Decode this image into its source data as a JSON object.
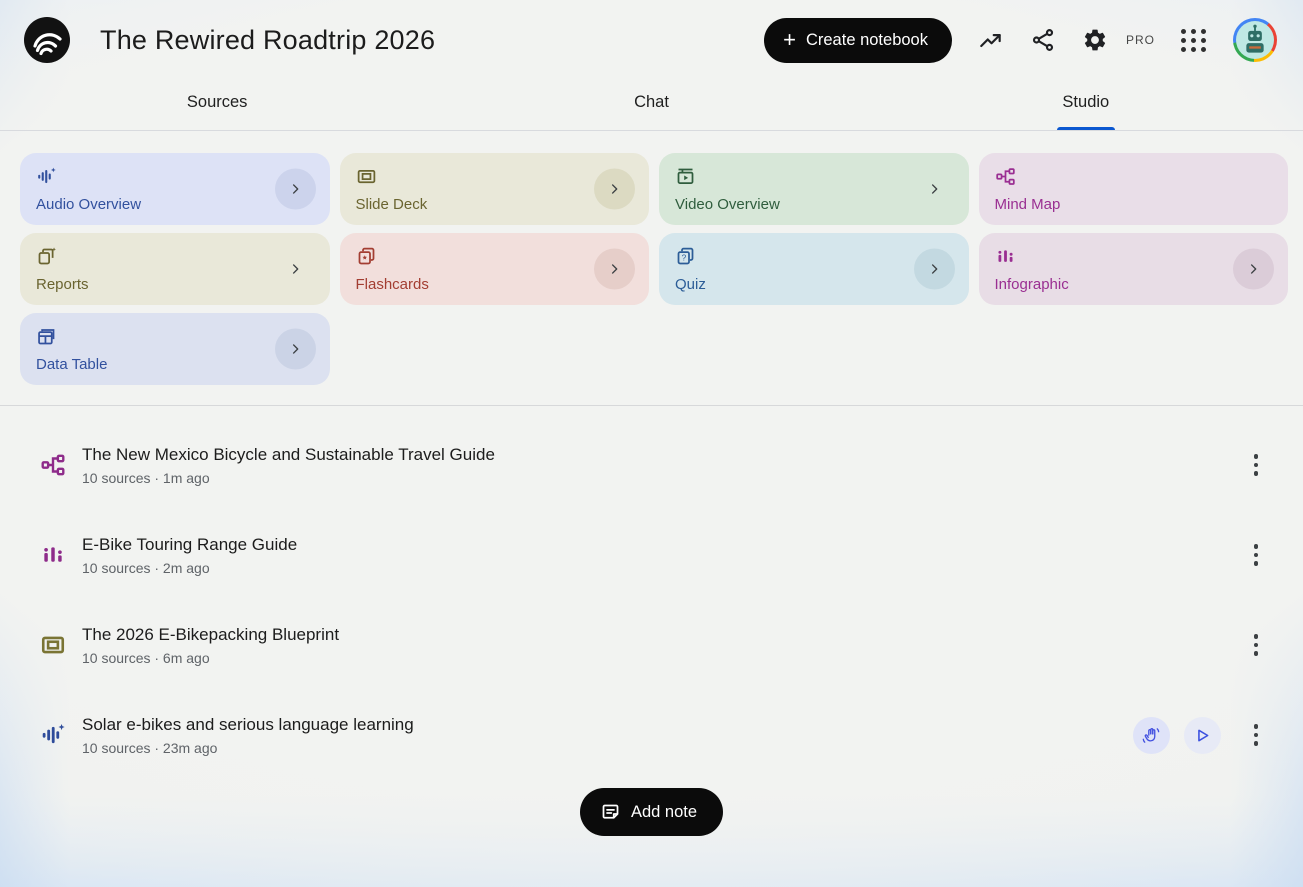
{
  "header": {
    "title": "The Rewired Roadtrip 2026",
    "create_button_label": "Create notebook",
    "plus_glyph": "+",
    "pro_label": "PRO",
    "icons": [
      "notebooklm-logo",
      "trending-up-icon",
      "share-icon",
      "settings-icon",
      "apps-grid-icon",
      "avatar"
    ]
  },
  "tabs": [
    {
      "label": "Sources",
      "active": false
    },
    {
      "label": "Chat",
      "active": false
    },
    {
      "label": "Studio",
      "active": true
    }
  ],
  "studio_cards": [
    {
      "label": "Audio Overview",
      "icon": "audio-waveform-icon",
      "bg": "#dde2f6",
      "fg": "#32519e",
      "chevron": "circle"
    },
    {
      "label": "Slide Deck",
      "icon": "slide-deck-icon",
      "bg": "#e9e8d9",
      "fg": "#6a6430",
      "chevron": "circle"
    },
    {
      "label": "Video Overview",
      "icon": "video-overview-icon",
      "bg": "#d7e7d8",
      "fg": "#2f5d3d",
      "chevron": "bare"
    },
    {
      "label": "Mind Map",
      "icon": "mind-map-icon",
      "bg": "#e9dee8",
      "fg": "#9a2f92",
      "chevron": "none"
    },
    {
      "label": "Reports",
      "icon": "reports-icon",
      "bg": "#e9e8d9",
      "fg": "#6a6430",
      "chevron": "bare"
    },
    {
      "label": "Flashcards",
      "icon": "flashcards-icon",
      "bg": "#f2dfdc",
      "fg": "#a33e32",
      "chevron": "circle"
    },
    {
      "label": "Quiz",
      "icon": "quiz-icon",
      "bg": "#d5e6ec",
      "fg": "#2c5d97",
      "chevron": "circle"
    },
    {
      "label": "Infographic",
      "icon": "infographic-icon",
      "bg": "#e8dde6",
      "fg": "#9a2f92",
      "chevron": "circle"
    },
    {
      "label": "Data Table",
      "icon": "data-table-icon",
      "bg": "#dce1f0",
      "fg": "#32519e",
      "chevron": "circle"
    }
  ],
  "artifacts": [
    {
      "icon": "mind-map-icon",
      "title": "The New Mexico Bicycle and Sustainable Travel Guide",
      "meta": "10 sources · 1m ago"
    },
    {
      "icon": "infographic-icon",
      "title": "E-Bike Touring Range Guide",
      "meta": "10 sources · 2m ago"
    },
    {
      "icon": "slide-deck-icon",
      "title": "The 2026 E-Bikepacking Blueprint",
      "meta": "10 sources · 6m ago"
    },
    {
      "icon": "audio-waveform-icon",
      "title": "Solar e-bikes and serious language learning",
      "meta": "10 sources · 23m ago",
      "actions": [
        "interactive-mode-hand",
        "play"
      ]
    }
  ],
  "add_note_label": "Add note",
  "colors": {
    "tab_accent": "#0b57d0",
    "primary_button_bg": "#0b0b0b",
    "action_icon_blue": "#4452e0",
    "meta_text": "#5f6368"
  }
}
